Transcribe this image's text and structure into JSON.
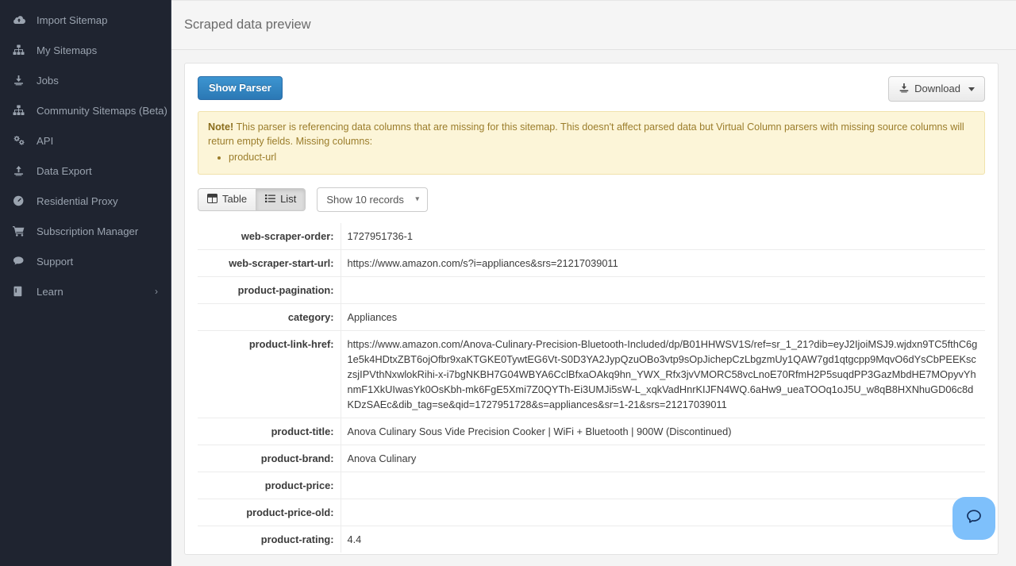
{
  "sidebar": {
    "items": [
      {
        "label": "Import Sitemap",
        "icon": "cloud-upload-icon"
      },
      {
        "label": "My Sitemaps",
        "icon": "sitemap-icon"
      },
      {
        "label": "Jobs",
        "icon": "download-icon"
      },
      {
        "label": "Community Sitemaps (Beta)",
        "icon": "sitemap-icon"
      },
      {
        "label": "API",
        "icon": "gears-icon"
      },
      {
        "label": "Data Export",
        "icon": "upload-icon"
      },
      {
        "label": "Residential Proxy",
        "icon": "gauge-icon"
      },
      {
        "label": "Subscription Manager",
        "icon": "cart-icon"
      },
      {
        "label": "Support",
        "icon": "comment-icon"
      },
      {
        "label": "Learn",
        "icon": "book-icon",
        "chevron": "›"
      }
    ]
  },
  "header": {
    "title": "Scraped data preview"
  },
  "toolbar": {
    "show_parser_label": "Show Parser",
    "download_label": "Download"
  },
  "note": {
    "prefix": "Note!",
    "text": " This parser is referencing data columns that are missing for this sitemap. This doesn't affect parsed data but Virtual Column parsers with missing source columns will return empty fields. Missing columns:",
    "missing_columns": [
      "product-url"
    ]
  },
  "controls": {
    "table_label": "Table",
    "list_label": "List",
    "active_view": "List",
    "records_selected": "Show 10 records",
    "records_options": [
      "Show 10 records"
    ]
  },
  "record": {
    "rows": [
      {
        "key": "web-scraper-order:",
        "value": "1727951736-1"
      },
      {
        "key": "web-scraper-start-url:",
        "value": "https://www.amazon.com/s?i=appliances&srs=21217039011"
      },
      {
        "key": "product-pagination:",
        "value": ""
      },
      {
        "key": "category:",
        "value": "Appliances"
      },
      {
        "key": "product-link-href:",
        "value": "https://www.amazon.com/Anova-Culinary-Precision-Bluetooth-Included/dp/B01HHWSV1S/ref=sr_1_21?dib=eyJ2IjoiMSJ9.wjdxn9TC5fthC6g1e5k4HDtxZBT6ojOfbr9xaKTGKE0TywtEG6Vt-S0D3YA2JypQzuOBo3vtp9sOpJichepCzLbgzmUy1QAW7gd1qtgcpp9MqvO6dYsCbPEEKsczsjIPVthNxwlokRihi-x-i7bgNKBH7G04WBYA6CclBfxaOAkq9hn_YWX_Rfx3jvVMORC58vcLnoE70RfmH2P5suqdPP3GazMbdHE7MOpyvYhnmF1XkUIwasYk0OsKbh-mk6FgE5Xmi7Z0QYTh-Ei3UMJi5sW-L_xqkVadHnrKIJFN4WQ.6aHw9_ueaTOOq1oJ5U_w8qB8HXNhuGD06c8dKDzSAEc&dib_tag=se&qid=1727951728&s=appliances&sr=1-21&srs=21217039011"
      },
      {
        "key": "product-title:",
        "value": "Anova Culinary Sous Vide Precision Cooker | WiFi + Bluetooth | 900W (Discontinued)"
      },
      {
        "key": "product-brand:",
        "value": "Anova Culinary"
      },
      {
        "key": "product-price:",
        "value": ""
      },
      {
        "key": "product-price-old:",
        "value": ""
      },
      {
        "key": "product-rating:",
        "value": "4.4"
      }
    ]
  },
  "chat": {
    "icon": "chat-bubble-icon"
  },
  "annotation": {
    "highlight_target": "Download",
    "color": "#f03d1c"
  },
  "colors": {
    "sidebar_bg": "#1f2430",
    "primary_button": "#2b78b5",
    "note_bg": "#fcf5d8",
    "chat_bg": "#7ec0fb"
  }
}
